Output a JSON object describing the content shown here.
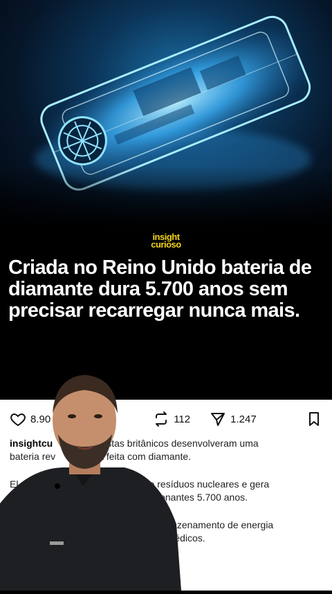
{
  "brand": {
    "line1": "insight",
    "line2": "curioso"
  },
  "headline": "Criada no Reino Unido bateria de diamante dura 5.700 anos sem precisar recarregar nunca mais.",
  "actions": {
    "likes": "8.90",
    "reposts": "112",
    "shares": "1.247"
  },
  "caption": {
    "username": "insightcu",
    "line1": "stas britânicos desenvolveram uma",
    "line2a": "bateria rev",
    "line2b": "a feita com diamante.",
    "line3a": "El",
    "line3b": "ído de resíduos nucleares e gera",
    "line4": "ionantes 5.700 anos.",
    "line5": "armazenamento de energia",
    "line6": "es médicos."
  },
  "colors": {
    "brand_yellow": "#f2d21c",
    "glow_blue": "#4fc3ff"
  }
}
